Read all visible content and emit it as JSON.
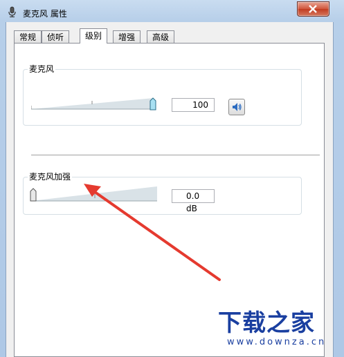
{
  "window": {
    "title": "麦克风 属性",
    "close_symbol": "✕"
  },
  "tabs": [
    {
      "label": "常规",
      "active": false
    },
    {
      "label": "侦听",
      "active": false
    },
    {
      "label": "级别",
      "active": true
    },
    {
      "label": "增强",
      "active": false
    },
    {
      "label": "高级",
      "active": false
    }
  ],
  "microphone": {
    "label": "麦克风",
    "level": 100,
    "level_fraction": 1.0,
    "value_text": "100",
    "speaker_icon": "speaker-volume-icon"
  },
  "boost": {
    "label": "麦克风加强",
    "level_fraction": 0.0,
    "value_text": "0.0 dB"
  },
  "annotation": {
    "arrow_color": "#e53a2f"
  },
  "watermark": {
    "logo": "下载之家",
    "url": "www.downza.cn"
  },
  "colors": {
    "accent": "#1a3fa0",
    "slider_thumb": "#9fd8ee"
  }
}
